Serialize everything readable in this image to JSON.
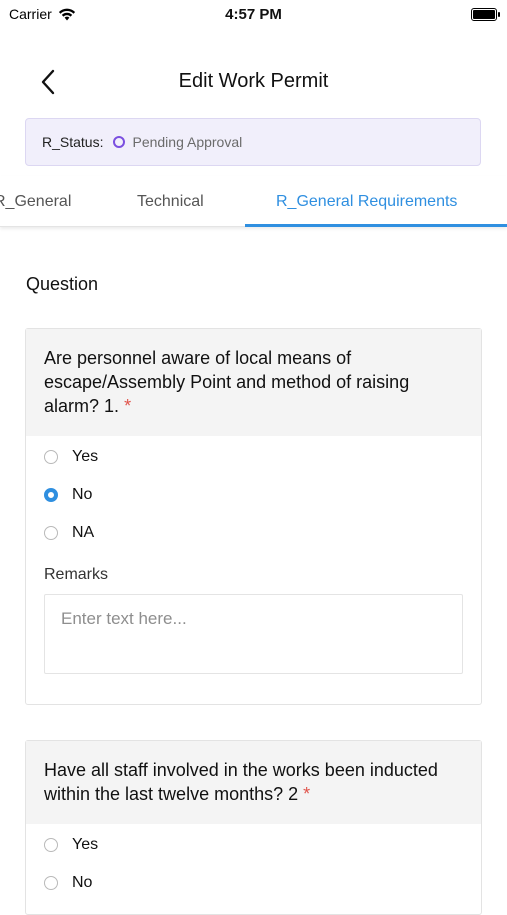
{
  "status_bar": {
    "carrier": "Carrier",
    "time": "4:57 PM"
  },
  "nav": {
    "title": "Edit Work Permit"
  },
  "permit_status": {
    "label": "R_Status:",
    "value": "Pending Approval",
    "dot_color": "#7b4fe0"
  },
  "tabs": [
    {
      "label": "R_General"
    },
    {
      "label": "Technical"
    },
    {
      "label": "R_General Requirements",
      "active": true
    }
  ],
  "section": {
    "title": "Question"
  },
  "questions": [
    {
      "text": "Are personnel aware of local means of escape/Assembly Point and method of raising alarm? 1.",
      "required_mark": "*",
      "options": [
        "Yes",
        "No",
        "NA"
      ],
      "selected": "No",
      "remarks_label": "Remarks",
      "remarks_placeholder": "Enter text here..."
    },
    {
      "text": "Have all staff involved in the works been inducted within the last twelve months? 2",
      "required_mark": "*",
      "options": [
        "Yes",
        "No"
      ]
    }
  ],
  "colors": {
    "accent": "#2f8fe0",
    "required": "#e0534a",
    "pending": "#7b4fe0"
  }
}
